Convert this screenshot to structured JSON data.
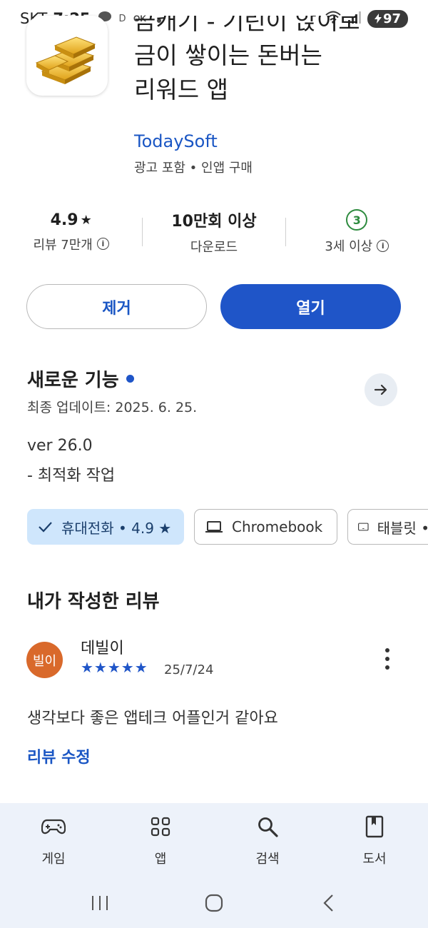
{
  "status_bar": {
    "carrier": "SKT",
    "time": "7:25",
    "notif_letter": "D",
    "battery": "97"
  },
  "app": {
    "title_line1": "금캐기 - 기린이 앉이로",
    "title_line2": "금이 쌓이는 돈버는",
    "title_line3": "리워드 앱",
    "developer": "TodaySoft",
    "ad_info": "광고 포함 • 인앱 구매"
  },
  "stats": {
    "rating": "4.9",
    "rating_label": "리뷰 7만개",
    "downloads": "10만회 이상",
    "downloads_label": "다운로드",
    "age_rating": "3",
    "age_label": "3세 이상"
  },
  "buttons": {
    "remove": "제거",
    "open": "열기"
  },
  "whats_new": {
    "title": "새로운 기능",
    "updated": "최종 업데이트: 2025. 6. 25.",
    "version": "ver 26.0",
    "changelog": "- 최적화 작업"
  },
  "devices": {
    "phone": "휴대전화 • 4.9 ★",
    "chromebook": "Chromebook",
    "tablet": "태블릿 •"
  },
  "my_review": {
    "heading": "내가 작성한 리뷰",
    "avatar_text": "빌이",
    "name": "데빌이",
    "stars": "★★★★★",
    "rating": 5,
    "date": "25/7/24",
    "text": "생각보다 좋은 앱테크 어플인거 같아요",
    "edit": "리뷰 수정"
  },
  "bottom_nav": {
    "items": [
      {
        "label": "게임",
        "icon": "gamepad-icon"
      },
      {
        "label": "앱",
        "icon": "apps-grid-icon"
      },
      {
        "label": "검색",
        "icon": "search-icon"
      },
      {
        "label": "도서",
        "icon": "book-icon"
      }
    ]
  },
  "colors": {
    "accent": "#1f55c8",
    "chip_selected_bg": "#cfe6fc",
    "age_green": "#2e8b3f",
    "avatar_bg": "#d9692b"
  }
}
